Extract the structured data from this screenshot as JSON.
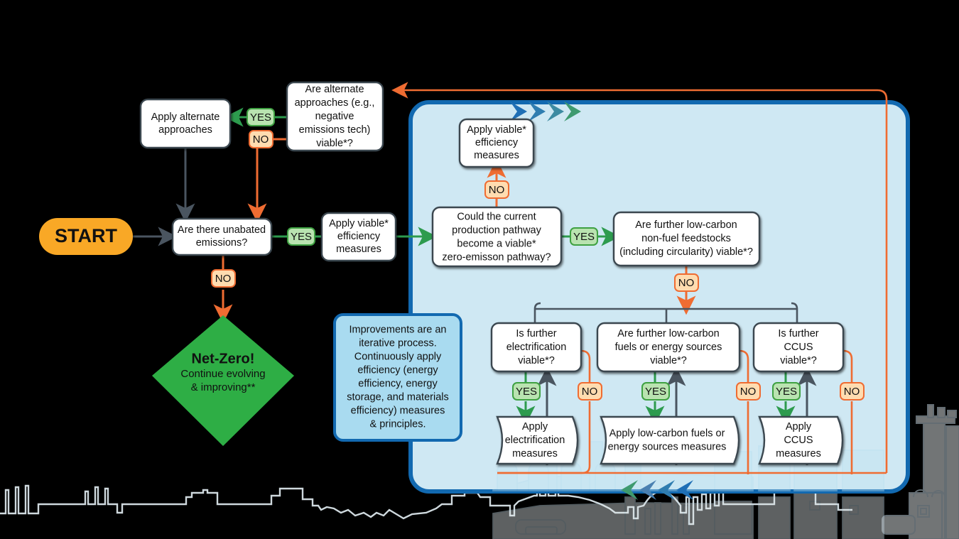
{
  "diagram": {
    "title": "Net-Zero decision flowchart",
    "colors": {
      "background": "#000000",
      "panel_fill": "#cfe8f3",
      "panel_border": "#1269b0",
      "yes_fill": "#b9e3b0",
      "yes_border": "#3fa142",
      "no_fill": "#ffdcb0",
      "no_border": "#ef6c32",
      "green_line": "#2d9b4e",
      "orange_line": "#ef6c32",
      "gray_line": "#4a5560",
      "start_fill": "#f9a825",
      "netzero_fill": "#2fae45",
      "info_fill": "#a9dbf0",
      "info_border": "#1269b0",
      "node_fill": "#ffffff",
      "node_border": "#3b4650",
      "skyline": "#eaf6fb"
    }
  },
  "nodes": {
    "start": {
      "label": "START"
    },
    "unabated": {
      "label": "Are there unabated emissions?"
    },
    "alternate_q": {
      "label": "Are alternate approaches (e.g., negative emissions tech) viable*?"
    },
    "apply_alternate": {
      "label": "Apply alternate approaches"
    },
    "netzero": {
      "title": "Net-Zero!",
      "subtitle_1": "Continue evolving",
      "subtitle_2": "& improving**"
    },
    "apply_eff_left": {
      "label": "Apply viable* efficiency measures"
    },
    "apply_eff_top": {
      "label": "Apply viable* efficiency measures"
    },
    "pathway_q": {
      "label": "Could the current production pathway become a viable* zero-emisson pathway?"
    },
    "feedstocks_q": {
      "label": "Are further low-carbon non-fuel feedstocks (including circularity) viable*?"
    },
    "electrification_q": {
      "label": "Is further electrification viable*?"
    },
    "fuels_q": {
      "label": "Are further low-carbon fuels or energy sources viable*?"
    },
    "ccus_q": {
      "label": "Is further CCUS viable*?"
    },
    "apply_electrification": {
      "label": "Apply electrification measures"
    },
    "apply_fuels": {
      "label": "Apply low-carbon fuels or energy sources measures"
    },
    "apply_ccus": {
      "label": "Apply CCUS measures"
    },
    "info_note": {
      "label": "Improvements are an iterative process. Continuously apply efficiency (energy efficiency, energy storage, and materials efficiency) measures & principles."
    }
  },
  "node_lines": {
    "unabated": [
      "Are there unabated",
      "emissions?"
    ],
    "alternate_q": [
      "Are alternate",
      "approaches (e.g.,",
      "negative",
      "emissions tech)",
      "viable*?"
    ],
    "apply_alternate": [
      "Apply alternate",
      "approaches"
    ],
    "apply_eff_left": [
      "Apply viable*",
      "efficiency",
      "measures"
    ],
    "apply_eff_top": [
      "Apply viable*",
      "efficiency",
      "measures"
    ],
    "pathway_q": [
      "Could the current",
      "production pathway",
      "become a viable*",
      "zero-emisson pathway?"
    ],
    "feedstocks_q": [
      "Are further low-carbon",
      "non-fuel feedstocks",
      "(including circularity) viable*?"
    ],
    "electrification_q": [
      "Is further",
      "electrification",
      "viable*?"
    ],
    "fuels_q": [
      "Are further low-carbon",
      "fuels or energy sources",
      "viable*?"
    ],
    "ccus_q": [
      "Is further",
      "CCUS",
      "viable*?"
    ],
    "apply_electrification": [
      "Apply",
      "electrification",
      "measures"
    ],
    "apply_fuels": [
      "Apply low-carbon fuels or",
      "energy sources measures"
    ],
    "apply_ccus": [
      "Apply",
      "CCUS",
      "measures"
    ],
    "info_note": [
      "Improvements are an",
      "iterative process.",
      "Continuously apply",
      "efficiency (energy",
      "efficiency, energy",
      "storage, and materials",
      "efficiency) measures",
      "& principles."
    ]
  },
  "labels": {
    "yes": "YES",
    "no": "NO"
  },
  "edge_labels": [
    {
      "id": "alternate-yes",
      "text": "YES",
      "kind": "yes"
    },
    {
      "id": "alternate-no",
      "text": "NO",
      "kind": "no"
    },
    {
      "id": "unabated-yes",
      "text": "YES",
      "kind": "yes"
    },
    {
      "id": "unabated-no",
      "text": "NO",
      "kind": "no"
    },
    {
      "id": "pathway-no",
      "text": "NO",
      "kind": "no"
    },
    {
      "id": "pathway-yes",
      "text": "YES",
      "kind": "yes"
    },
    {
      "id": "feedstocks-no",
      "text": "NO",
      "kind": "no"
    },
    {
      "id": "electrification-yes",
      "text": "YES",
      "kind": "yes"
    },
    {
      "id": "electrification-no",
      "text": "NO",
      "kind": "no"
    },
    {
      "id": "fuels-yes",
      "text": "YES",
      "kind": "yes"
    },
    {
      "id": "fuels-no",
      "text": "NO",
      "kind": "no"
    },
    {
      "id": "ccus-yes",
      "text": "YES",
      "kind": "yes"
    },
    {
      "id": "ccus-no",
      "text": "NO",
      "kind": "no"
    }
  ]
}
